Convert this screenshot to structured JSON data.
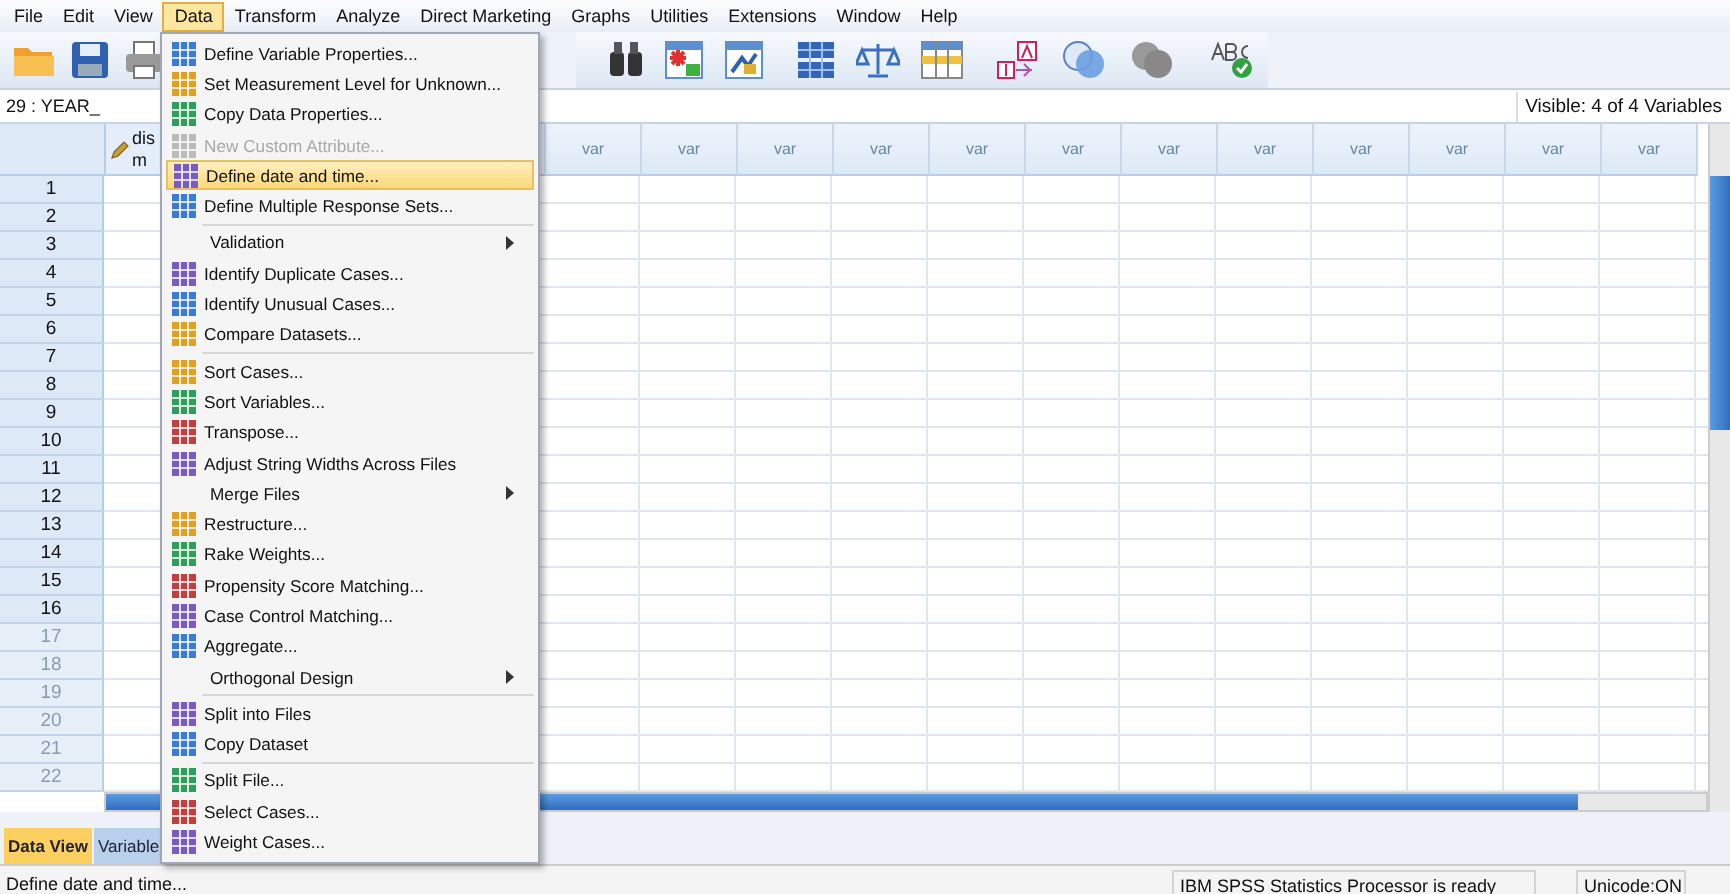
{
  "menubar": [
    {
      "label": "File",
      "selected": false
    },
    {
      "label": "Edit",
      "selected": false
    },
    {
      "label": "View",
      "selected": false
    },
    {
      "label": "Data",
      "selected": true
    },
    {
      "label": "Transform",
      "selected": false
    },
    {
      "label": "Analyze",
      "selected": false
    },
    {
      "label": "Direct Marketing",
      "selected": false
    },
    {
      "label": "Graphs",
      "selected": false
    },
    {
      "label": "Utilities",
      "selected": false
    },
    {
      "label": "Extensions",
      "selected": false
    },
    {
      "label": "Window",
      "selected": false
    },
    {
      "label": "Help",
      "selected": false
    }
  ],
  "cell_editor": {
    "cell": "29 : YEAR_",
    "visible": "Visible: 4 of 4 Variables"
  },
  "grid": {
    "first_column": {
      "line_1": "dis",
      "line_2": "m"
    },
    "columns": [
      "var",
      "var",
      "var",
      "var",
      "var",
      "var",
      "var",
      "var",
      "var",
      "var",
      "var",
      "var"
    ],
    "rows": [
      {
        "label": "1",
        "dimmed": false
      },
      {
        "label": "2",
        "dimmed": false
      },
      {
        "label": "3",
        "dimmed": false
      },
      {
        "label": "4",
        "dimmed": false
      },
      {
        "label": "5",
        "dimmed": false
      },
      {
        "label": "6",
        "dimmed": false
      },
      {
        "label": "7",
        "dimmed": false
      },
      {
        "label": "8",
        "dimmed": false
      },
      {
        "label": "9",
        "dimmed": false
      },
      {
        "label": "10",
        "dimmed": false
      },
      {
        "label": "11",
        "dimmed": false
      },
      {
        "label": "12",
        "dimmed": false
      },
      {
        "label": "13",
        "dimmed": false
      },
      {
        "label": "14",
        "dimmed": false
      },
      {
        "label": "15",
        "dimmed": false
      },
      {
        "label": "16",
        "dimmed": false
      },
      {
        "label": "17",
        "dimmed": true
      },
      {
        "label": "18",
        "dimmed": true
      },
      {
        "label": "19",
        "dimmed": true
      },
      {
        "label": "20",
        "dimmed": true
      },
      {
        "label": "21",
        "dimmed": true
      },
      {
        "label": "22",
        "dimmed": true
      }
    ]
  },
  "data_menu": {
    "groups": [
      [
        {
          "kind": "command",
          "label": "Define Variable Properties...",
          "disabled": false,
          "selected": false
        },
        {
          "kind": "command",
          "label": "Set Measurement Level for Unknown...",
          "disabled": false,
          "selected": false
        },
        {
          "kind": "command",
          "label": "Copy Data Properties...",
          "disabled": false,
          "selected": false
        },
        {
          "kind": "command",
          "label": "New Custom Attribute...",
          "disabled": true,
          "selected": false
        },
        {
          "kind": "command",
          "label": "Define date and time...",
          "disabled": false,
          "selected": true
        },
        {
          "kind": "command",
          "label": "Define Multiple Response Sets...",
          "disabled": false,
          "selected": false
        }
      ],
      [
        {
          "kind": "submenu",
          "label": "Validation",
          "disabled": false,
          "selected": false
        },
        {
          "kind": "command",
          "label": "Identify Duplicate Cases...",
          "disabled": false,
          "selected": false
        },
        {
          "kind": "command",
          "label": "Identify Unusual Cases...",
          "disabled": false,
          "selected": false
        },
        {
          "kind": "command",
          "label": "Compare Datasets...",
          "disabled": false,
          "selected": false
        }
      ],
      [
        {
          "kind": "command",
          "label": "Sort Cases...",
          "disabled": false,
          "selected": false
        },
        {
          "kind": "command",
          "label": "Sort Variables...",
          "disabled": false,
          "selected": false
        },
        {
          "kind": "command",
          "label": "Transpose...",
          "disabled": false,
          "selected": false
        },
        {
          "kind": "command",
          "label": "Adjust String Widths Across Files",
          "disabled": false,
          "selected": false
        },
        {
          "kind": "submenu",
          "label": "Merge Files",
          "disabled": false,
          "selected": false
        },
        {
          "kind": "command",
          "label": "Restructure...",
          "disabled": false,
          "selected": false
        },
        {
          "kind": "command",
          "label": "Rake Weights...",
          "disabled": false,
          "selected": false
        },
        {
          "kind": "command",
          "label": "Propensity Score Matching...",
          "disabled": false,
          "selected": false
        },
        {
          "kind": "command",
          "label": "Case Control Matching...",
          "disabled": false,
          "selected": false
        },
        {
          "kind": "command",
          "label": "Aggregate...",
          "disabled": false,
          "selected": false
        },
        {
          "kind": "submenu",
          "label": "Orthogonal Design",
          "disabled": false,
          "selected": false
        }
      ],
      [
        {
          "kind": "command",
          "label": "Split into Files",
          "disabled": false,
          "selected": false
        },
        {
          "kind": "command",
          "label": "Copy Dataset",
          "disabled": false,
          "selected": false
        }
      ],
      [
        {
          "kind": "command",
          "label": "Split File...",
          "disabled": false,
          "selected": false
        },
        {
          "kind": "command",
          "label": "Select Cases...",
          "disabled": false,
          "selected": false
        },
        {
          "kind": "command",
          "label": "Weight Cases...",
          "disabled": false,
          "selected": false
        }
      ]
    ]
  },
  "view_tabs": [
    {
      "label": "Data View",
      "selected": true
    },
    {
      "label": "Variable",
      "selected": false
    }
  ],
  "status_bar": {
    "message": "Define date and time...",
    "processor": "IBM SPSS Statistics Processor is ready",
    "unicode": "Unicode:ON"
  }
}
